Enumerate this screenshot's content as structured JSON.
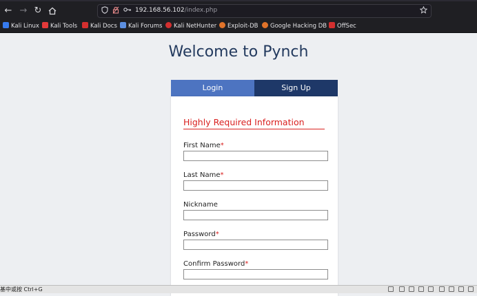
{
  "browser": {
    "url_host": "192.168.56.102",
    "url_path": "/index.php",
    "icons": [
      "back-icon",
      "forward-icon",
      "reload-icon",
      "home-icon",
      "shield-icon",
      "lock-icon",
      "key-icon",
      "star-icon"
    ]
  },
  "bookmarks": [
    {
      "label": "Kali Linux",
      "color": "#367bf0"
    },
    {
      "label": "Kali Tools",
      "color": "#e33a3a"
    },
    {
      "label": "Kali Docs",
      "color": "#d32f2f"
    },
    {
      "label": "Kali Forums",
      "color": "#5c8fe0"
    },
    {
      "label": "Kali NetHunter",
      "color": "#d32f2f"
    },
    {
      "label": "Exploit-DB",
      "color": "#e0732a"
    },
    {
      "label": "Google Hacking DB",
      "color": "#e0732a"
    },
    {
      "label": "OffSec",
      "color": "#d32f2f"
    }
  ],
  "page": {
    "title": "Welcome to Pynch",
    "tabs": {
      "login": "Login",
      "signup": "Sign Up"
    },
    "section_title": "Highly Required Information",
    "required_marker": "*",
    "fields": [
      {
        "label": "First Name",
        "required": true,
        "value": ""
      },
      {
        "label": "Last Name",
        "required": true,
        "value": ""
      },
      {
        "label": "Nickname",
        "required": false,
        "value": ""
      },
      {
        "label": "Password",
        "required": true,
        "value": ""
      },
      {
        "label": "Confirm Password",
        "required": true,
        "value": ""
      }
    ]
  },
  "statusbar": {
    "text": "基中或按 Ctrl+G"
  },
  "colors": {
    "title": "#233a5e",
    "login_tab": "#4d74c1",
    "signup_tab": "#1e3868",
    "required": "#d9201f"
  }
}
